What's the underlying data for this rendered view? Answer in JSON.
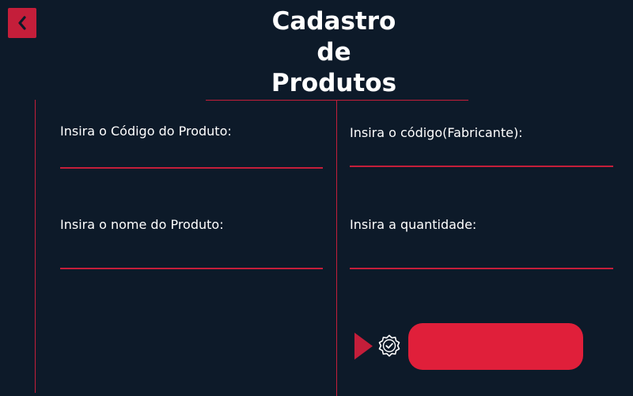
{
  "header": {
    "title_lines": [
      "Cadastro",
      "de",
      "Produtos"
    ],
    "back_icon": "chevron-left-icon"
  },
  "form": {
    "product_code_label": "Insira o Código do Produto:",
    "manufacturer_code_label": "Insira o código(Fabricante):",
    "product_name_label": "Insira o nome do Produto:",
    "quantity_label": "Insira a quantidade:",
    "product_code_value": "",
    "manufacturer_code_value": "",
    "product_name_value": "",
    "quantity_value": ""
  },
  "submit": {
    "label": "",
    "arrow_icon": "play-arrow-icon",
    "badge_icon": "verified-badge-icon"
  },
  "colors": {
    "background": "#0d1a29",
    "accent": "#c41e3a",
    "button": "#e01f3a",
    "text": "#ffffff"
  }
}
